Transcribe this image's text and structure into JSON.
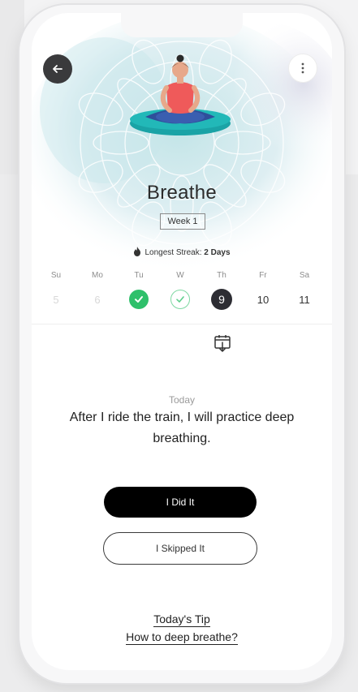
{
  "header": {
    "title": "Breathe",
    "week_label": "Week 1",
    "streak_label": "Longest Streak:",
    "streak_value": "2 Days"
  },
  "icons": {
    "back": "arrow-left-icon",
    "more": "more-vertical-icon",
    "streak": "flame-icon",
    "calendar": "calendar-download-icon",
    "hero": "meditation-illustration"
  },
  "colors": {
    "accent_green": "#2fc06b",
    "today_circle": "#2d2d33",
    "primary_button": "#000000"
  },
  "week": [
    {
      "name": "Su",
      "value": "5",
      "state": "past"
    },
    {
      "name": "Mo",
      "value": "6",
      "state": "past"
    },
    {
      "name": "Tu",
      "value": "",
      "state": "done"
    },
    {
      "name": "W",
      "value": "",
      "state": "check-outline"
    },
    {
      "name": "Th",
      "value": "9",
      "state": "today"
    },
    {
      "name": "Fr",
      "value": "10",
      "state": "future"
    },
    {
      "name": "Sa",
      "value": "11",
      "state": "future"
    }
  ],
  "main": {
    "today_label": "Today",
    "intention": "After I ride the train, I will practice deep breathing.",
    "did_button": "I Did It",
    "skip_button": "I Skipped It"
  },
  "tip": {
    "title": "Today's Tip",
    "link": "How to deep breathe?"
  }
}
